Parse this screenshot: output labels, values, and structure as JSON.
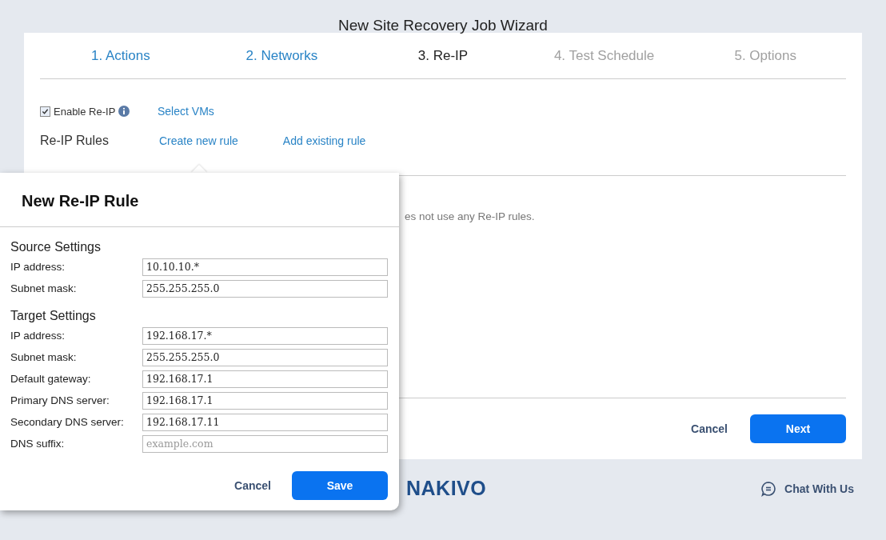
{
  "window": {
    "title": "New Site Recovery Job Wizard"
  },
  "tabs": [
    {
      "label": "1. Actions",
      "selected": false,
      "disabled": false
    },
    {
      "label": "2. Networks",
      "selected": false,
      "disabled": false
    },
    {
      "label": "3. Re-IP",
      "selected": true,
      "disabled": false
    },
    {
      "label": "4. Test Schedule",
      "selected": false,
      "disabled": true
    },
    {
      "label": "5. Options",
      "selected": false,
      "disabled": true
    }
  ],
  "enable_reip": {
    "label": "Enable Re-IP",
    "checked": true
  },
  "select_vms": "Select VMs",
  "rules": {
    "title": "Re-IP Rules",
    "links": [
      "Create new rule",
      "Add existing rule"
    ],
    "empty_text": "es not use any Re-IP rules."
  },
  "footer_buttons": {
    "cancel": "Cancel",
    "next": "Next"
  },
  "logo": "NAKIVO",
  "chat": "Chat With Us",
  "dialog": {
    "title": "New Re-IP Rule",
    "sections": [
      {
        "title": "Source Settings",
        "fields": [
          {
            "label": "IP address:",
            "value": "10.10.10.*"
          },
          {
            "label": "Subnet mask:",
            "value": "255.255.255.0"
          }
        ]
      },
      {
        "title": "Target Settings",
        "fields": [
          {
            "label": "IP address:",
            "value": "192.168.17.*"
          },
          {
            "label": "Subnet mask:",
            "value": "255.255.255.0"
          },
          {
            "label": "Default gateway:",
            "value": "192.168.17.1"
          },
          {
            "label": "Primary DNS server:",
            "value": "192.168.17.1"
          },
          {
            "label": "Secondary DNS server:",
            "value": "192.168.17.11"
          },
          {
            "label": "DNS suffix:",
            "placeholder": "example.com"
          }
        ]
      }
    ],
    "buttons": {
      "cancel": "Cancel",
      "save": "Save"
    }
  }
}
